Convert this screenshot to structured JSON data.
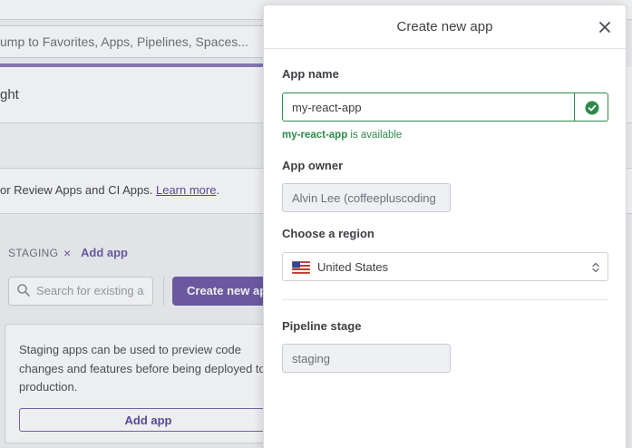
{
  "background": {
    "jump_text": "ump to Favorites, Apps, Pipelines, Spaces...",
    "header_text": "ght",
    "info_text": "or Review Apps and CI Apps. ",
    "info_link": "Learn more",
    "info_period": ".",
    "staging_label": "STAGING",
    "remove_symbol": "×",
    "add_app_link": "Add app",
    "search_placeholder": "Search for existing a",
    "create_button": "Create new ap",
    "card_text": "Staging apps can be used to preview code changes and features before being deployed to production.",
    "card_button": "Add app"
  },
  "modal": {
    "title": "Create new app",
    "close_icon": "close-icon",
    "app_name": {
      "label": "App name",
      "value": "my-react-app",
      "status_icon": "check-circle-icon",
      "availability_name": "my-react-app",
      "availability_text": " is available"
    },
    "app_owner": {
      "label": "App owner",
      "value": "Alvin Lee (coffeepluscoding"
    },
    "region": {
      "label": "Choose a region",
      "selected": "United States",
      "flag_icon": "us-flag-icon"
    },
    "pipeline_stage": {
      "label": "Pipeline stage",
      "value": "staging"
    }
  },
  "colors": {
    "accent_purple": "#6e5aa8",
    "success_green": "#2f8a4a",
    "readonly_bg": "#eef0f4"
  }
}
